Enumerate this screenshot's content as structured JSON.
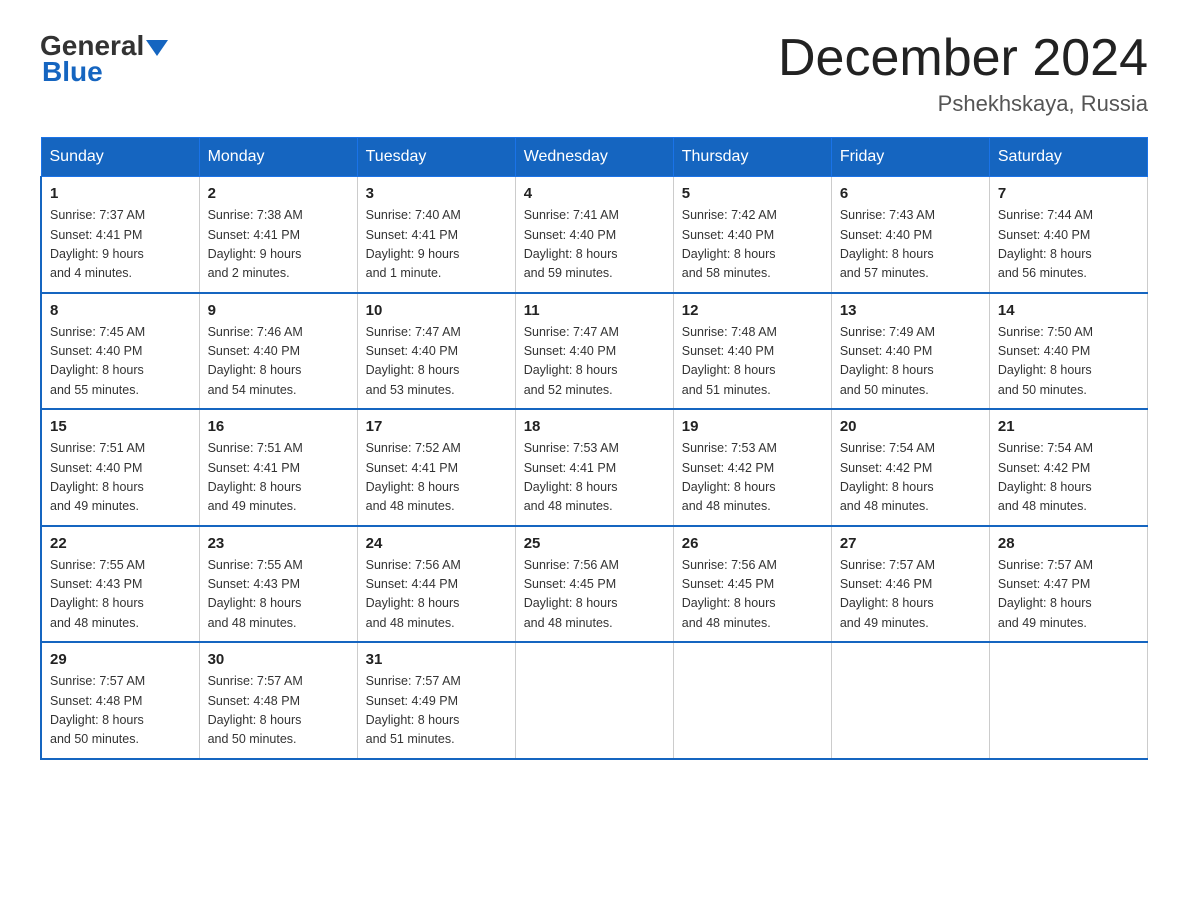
{
  "logo": {
    "general": "General",
    "blue": "Blue"
  },
  "title": "December 2024",
  "location": "Pshekhskaya, Russia",
  "weekdays": [
    "Sunday",
    "Monday",
    "Tuesday",
    "Wednesday",
    "Thursday",
    "Friday",
    "Saturday"
  ],
  "weeks": [
    [
      {
        "day": "1",
        "sunrise": "7:37 AM",
        "sunset": "4:41 PM",
        "daylight": "9 hours and 4 minutes."
      },
      {
        "day": "2",
        "sunrise": "7:38 AM",
        "sunset": "4:41 PM",
        "daylight": "9 hours and 2 minutes."
      },
      {
        "day": "3",
        "sunrise": "7:40 AM",
        "sunset": "4:41 PM",
        "daylight": "9 hours and 1 minute."
      },
      {
        "day": "4",
        "sunrise": "7:41 AM",
        "sunset": "4:40 PM",
        "daylight": "8 hours and 59 minutes."
      },
      {
        "day": "5",
        "sunrise": "7:42 AM",
        "sunset": "4:40 PM",
        "daylight": "8 hours and 58 minutes."
      },
      {
        "day": "6",
        "sunrise": "7:43 AM",
        "sunset": "4:40 PM",
        "daylight": "8 hours and 57 minutes."
      },
      {
        "day": "7",
        "sunrise": "7:44 AM",
        "sunset": "4:40 PM",
        "daylight": "8 hours and 56 minutes."
      }
    ],
    [
      {
        "day": "8",
        "sunrise": "7:45 AM",
        "sunset": "4:40 PM",
        "daylight": "8 hours and 55 minutes."
      },
      {
        "day": "9",
        "sunrise": "7:46 AM",
        "sunset": "4:40 PM",
        "daylight": "8 hours and 54 minutes."
      },
      {
        "day": "10",
        "sunrise": "7:47 AM",
        "sunset": "4:40 PM",
        "daylight": "8 hours and 53 minutes."
      },
      {
        "day": "11",
        "sunrise": "7:47 AM",
        "sunset": "4:40 PM",
        "daylight": "8 hours and 52 minutes."
      },
      {
        "day": "12",
        "sunrise": "7:48 AM",
        "sunset": "4:40 PM",
        "daylight": "8 hours and 51 minutes."
      },
      {
        "day": "13",
        "sunrise": "7:49 AM",
        "sunset": "4:40 PM",
        "daylight": "8 hours and 50 minutes."
      },
      {
        "day": "14",
        "sunrise": "7:50 AM",
        "sunset": "4:40 PM",
        "daylight": "8 hours and 50 minutes."
      }
    ],
    [
      {
        "day": "15",
        "sunrise": "7:51 AM",
        "sunset": "4:40 PM",
        "daylight": "8 hours and 49 minutes."
      },
      {
        "day": "16",
        "sunrise": "7:51 AM",
        "sunset": "4:41 PM",
        "daylight": "8 hours and 49 minutes."
      },
      {
        "day": "17",
        "sunrise": "7:52 AM",
        "sunset": "4:41 PM",
        "daylight": "8 hours and 48 minutes."
      },
      {
        "day": "18",
        "sunrise": "7:53 AM",
        "sunset": "4:41 PM",
        "daylight": "8 hours and 48 minutes."
      },
      {
        "day": "19",
        "sunrise": "7:53 AM",
        "sunset": "4:42 PM",
        "daylight": "8 hours and 48 minutes."
      },
      {
        "day": "20",
        "sunrise": "7:54 AM",
        "sunset": "4:42 PM",
        "daylight": "8 hours and 48 minutes."
      },
      {
        "day": "21",
        "sunrise": "7:54 AM",
        "sunset": "4:42 PM",
        "daylight": "8 hours and 48 minutes."
      }
    ],
    [
      {
        "day": "22",
        "sunrise": "7:55 AM",
        "sunset": "4:43 PM",
        "daylight": "8 hours and 48 minutes."
      },
      {
        "day": "23",
        "sunrise": "7:55 AM",
        "sunset": "4:43 PM",
        "daylight": "8 hours and 48 minutes."
      },
      {
        "day": "24",
        "sunrise": "7:56 AM",
        "sunset": "4:44 PM",
        "daylight": "8 hours and 48 minutes."
      },
      {
        "day": "25",
        "sunrise": "7:56 AM",
        "sunset": "4:45 PM",
        "daylight": "8 hours and 48 minutes."
      },
      {
        "day": "26",
        "sunrise": "7:56 AM",
        "sunset": "4:45 PM",
        "daylight": "8 hours and 48 minutes."
      },
      {
        "day": "27",
        "sunrise": "7:57 AM",
        "sunset": "4:46 PM",
        "daylight": "8 hours and 49 minutes."
      },
      {
        "day": "28",
        "sunrise": "7:57 AM",
        "sunset": "4:47 PM",
        "daylight": "8 hours and 49 minutes."
      }
    ],
    [
      {
        "day": "29",
        "sunrise": "7:57 AM",
        "sunset": "4:48 PM",
        "daylight": "8 hours and 50 minutes."
      },
      {
        "day": "30",
        "sunrise": "7:57 AM",
        "sunset": "4:48 PM",
        "daylight": "8 hours and 50 minutes."
      },
      {
        "day": "31",
        "sunrise": "7:57 AM",
        "sunset": "4:49 PM",
        "daylight": "8 hours and 51 minutes."
      },
      null,
      null,
      null,
      null
    ]
  ],
  "labels": {
    "sunrise": "Sunrise:",
    "sunset": "Sunset:",
    "daylight": "Daylight:"
  }
}
